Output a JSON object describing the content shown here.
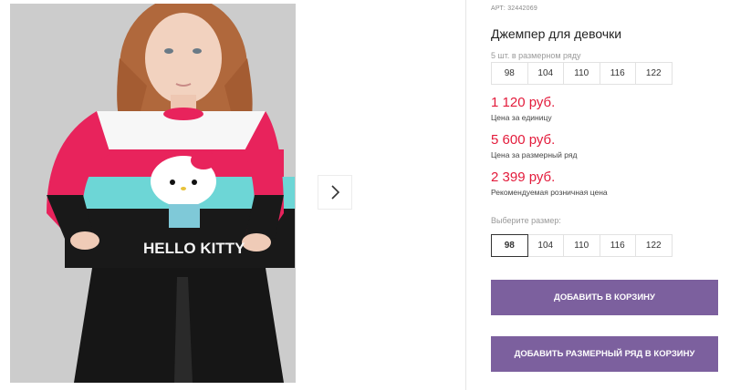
{
  "gallery": {
    "photo_label": "HELLO KITTY",
    "next_icon": "chevron-right-icon"
  },
  "product": {
    "article": "АРТ: 32442069",
    "title": "Джемпер для девочки",
    "pack_label": "5 шт. в размерном ряду",
    "pack_sizes": [
      "98",
      "104",
      "110",
      "116",
      "122"
    ]
  },
  "prices": [
    {
      "value": "1 120 руб.",
      "note": "Цена за единицу"
    },
    {
      "value": "5 600 руб.",
      "note": "Цена за размерный ряд"
    },
    {
      "value": "2 399 руб.",
      "note": "Рекомендуемая розничная цена"
    }
  ],
  "size_select": {
    "label": "Выберите размер:",
    "options": [
      "98",
      "104",
      "110",
      "116",
      "122"
    ],
    "selected": "98"
  },
  "actions": {
    "add_to_cart": "Добавить в корзину",
    "add_pack_to_cart": "Добавить размерный ряд в корзину"
  },
  "colors": {
    "accent": "#7c609e",
    "price": "#e31b3b"
  }
}
